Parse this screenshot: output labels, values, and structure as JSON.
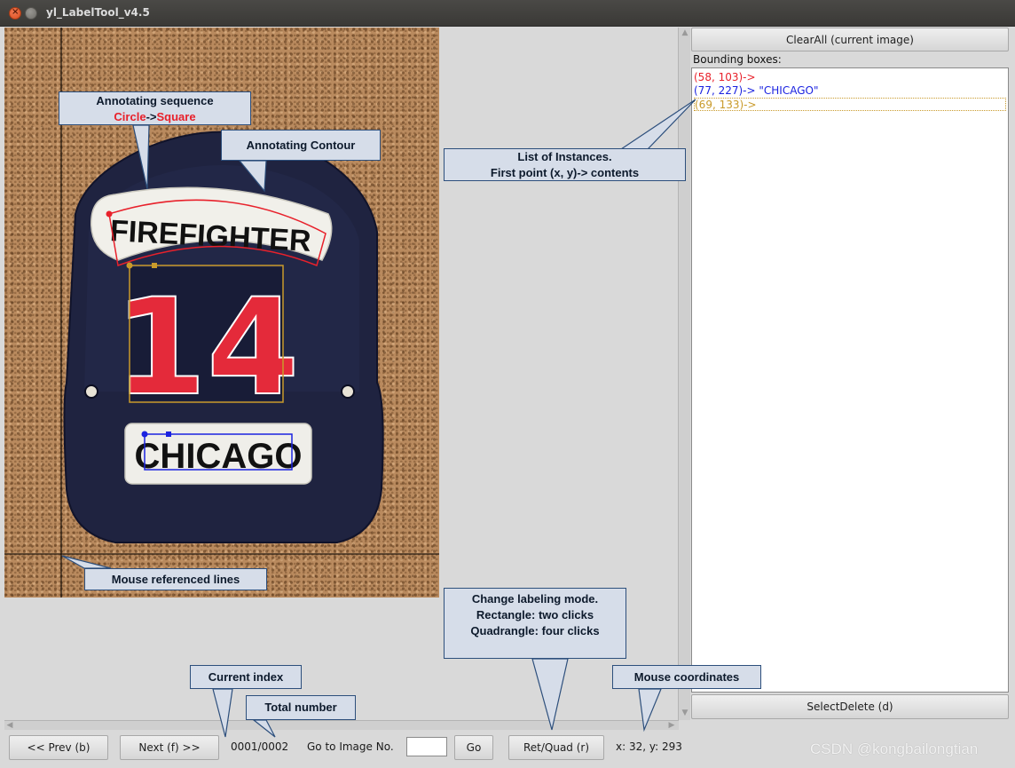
{
  "window": {
    "title": "yl_LabelTool_v4.5"
  },
  "image": {
    "badge_top_text": "FIREFIGHTER",
    "badge_number": "14",
    "badge_bottom_text": "CHICAGO"
  },
  "right_panel": {
    "clear_all_label": "ClearAll (current image)",
    "bounding_boxes_label": "Bounding boxes:",
    "boxes": [
      {
        "text": "(58, 103)->",
        "color": "#e8212b"
      },
      {
        "text": "(77, 227)-> \"CHICAGO\"",
        "color": "#1b23e0"
      },
      {
        "text": "(69, 133)->",
        "color": "#c99a2b"
      }
    ],
    "select_delete_label": "SelectDelete (d)"
  },
  "bottom_bar": {
    "prev_label": "<< Prev (b)",
    "next_label": "Next (f) >>",
    "index_text": "0001/0002",
    "goto_label": "Go to Image No.",
    "goto_value": "",
    "go_label": "Go",
    "mode_label": "Ret/Quad (r)",
    "mouse_coords": "x: 32, y: 293"
  },
  "annotations": {
    "sequence_title": "Annotating sequence",
    "sequence_circle": "Circle",
    "sequence_arrow": "->",
    "sequence_square": "Square",
    "contour": "Annotating Contour",
    "list_line1": "List of Instances.",
    "list_line2": "First point (x, y)-> contents",
    "mouse_lines": "Mouse referenced lines",
    "mode_line1": "Change labeling mode.",
    "mode_line2": "Rectangle: two clicks",
    "mode_line3": "Quadrangle: four clicks",
    "current_index": "Current index",
    "total_number": "Total number",
    "mouse_coordinates": "Mouse coordinates"
  },
  "watermark": "CSDN @kongbailongtian",
  "colors": {
    "circle_red": "#e8212b",
    "callout_fill": "#d6dde9",
    "callout_border": "#2d4f7c"
  }
}
